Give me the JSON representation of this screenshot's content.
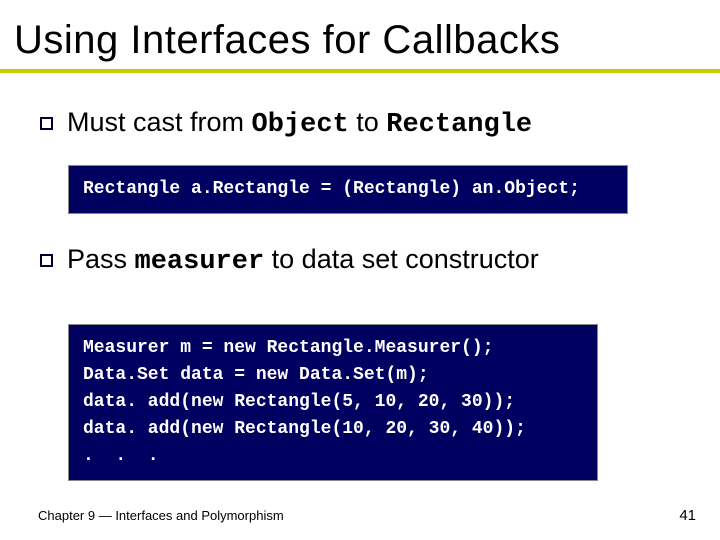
{
  "title": "Using Interfaces for Callbacks",
  "bullets": [
    {
      "pre": "Must cast from ",
      "code1": "Object",
      "mid": " to ",
      "code2": "Rectangle"
    },
    {
      "pre": "Pass ",
      "code1": "measurer",
      "mid": " to data set constructor",
      "code2": ""
    }
  ],
  "codebox1": "Rectangle a.Rectangle = (Rectangle) an.Object;",
  "codebox2": "Measurer m = new Rectangle.Measurer();\nData.Set data = new Data.Set(m);\ndata. add(new Rectangle(5, 10, 20, 30));\ndata. add(new Rectangle(10, 20, 30, 40));\n.  .  .",
  "footer": {
    "chapter": "Chapter 9 — Interfaces and Polymorphism",
    "page": "41"
  }
}
